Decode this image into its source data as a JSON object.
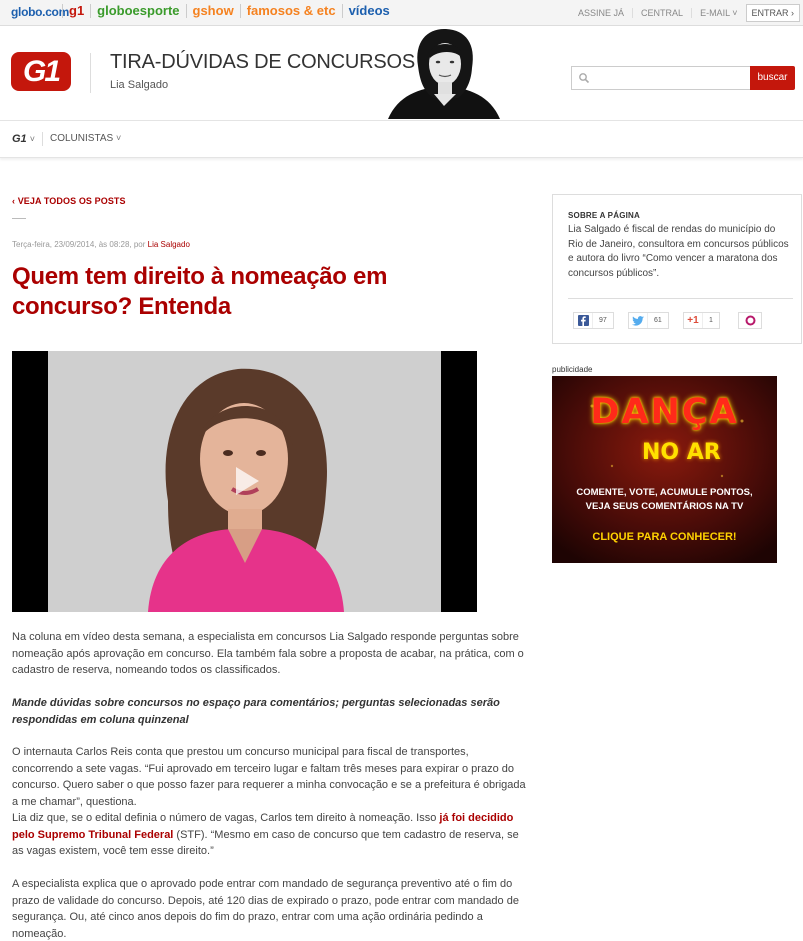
{
  "colors": {
    "brand_red": "#c4170c",
    "link_red": "#aa0000",
    "globo_blue": "#1c5fae",
    "g1_red": "#c4170c",
    "globoesporte_green": "#3a9b2b",
    "gshow_orange": "#f58220",
    "famosos_orange": "#f58220",
    "videos_blue": "#1c5fae"
  },
  "topbar": {
    "brand": "globo.com",
    "sites": [
      "g1",
      "globoesporte",
      "gshow",
      "famosos & etc",
      "vídeos"
    ],
    "links": [
      "ASSINE JÁ",
      "CENTRAL",
      "E-MAIL ˅",
      "ENTRAR ›"
    ]
  },
  "header": {
    "logo": "G1",
    "blog_title": "TIRA-DÚVIDAS DE CONCURSOS",
    "author": "Lia Salgado",
    "search_placeholder": "",
    "search_button": "buscar"
  },
  "nav": {
    "g1": "G1",
    "chevron": "˅",
    "colunistas": "COLUNISTAS"
  },
  "post": {
    "back": "‹ VEJA TODOS OS POSTS",
    "date_prefix": "Terça-feira, 23/09/2014, às 08:28, por ",
    "date_author": "Lia Salgado",
    "title": "Quem tem direito à nomeação em concurso? Entenda",
    "p1": "Na coluna em vídeo desta semana, a especialista em concursos Lia Salgado responde perguntas sobre nomeação após aprovação em concurso. Ela também fala sobre a proposta de acabar, na prática, com o cadastro de reserva, nomeando todos os classificados.",
    "p2": "Mande dúvidas sobre concursos no espaço para comentários; perguntas selecionadas serão respondidas em coluna quinzenal",
    "p3": "O internauta Carlos Reis conta que prestou um concurso municipal para fiscal de transportes, concorrendo a sete vagas. “Fui aprovado em terceiro lugar e faltam três meses para expirar o prazo do concurso. Quero saber o que posso fazer para requerer a minha convocação e se a prefeitura é obrigada a me chamar”, questiona.",
    "p4_a": "Lia diz que, se o edital definia o número de vagas, Carlos tem direito à nomeação. Isso ",
    "p4_link": "já foi decidido pelo Supremo Tribunal Federal",
    "p4_b": " (STF). “Mesmo em caso de concurso que tem cadastro de reserva, se as vagas existem, você tem esse direito.”",
    "p5": "A especialista explica que o aprovado pode entrar com mandado de segurança preventivo até o fim do prazo de validade do concurso. Depois, até 120 dias de expirado o prazo, pode entrar com mandado de segurança. Ou, até cinco anos depois do fim do prazo, entrar com uma ação ordinária pedindo a nomeação."
  },
  "sidebar": {
    "about_label": "SOBRE A PÁGINA",
    "about_text": "Lia Salgado é fiscal de rendas do município do Rio de Janeiro, consultora em concursos públicos e autora do livro “Como vencer a maratona dos concursos públicos”.",
    "share": {
      "facebook_count": "97",
      "twitter_count": "61",
      "gplus_label": "+1",
      "gplus_count": "1"
    },
    "ad_label": "publicidade",
    "ad": {
      "title": "DANÇA",
      "subtitle": "NO AR",
      "line1": "COMENTE, VOTE, ACUMULE PONTOS,",
      "line2": "VEJA SEUS COMENTÁRIOS NA TV",
      "cta": "CLIQUE PARA CONHECER!"
    }
  }
}
